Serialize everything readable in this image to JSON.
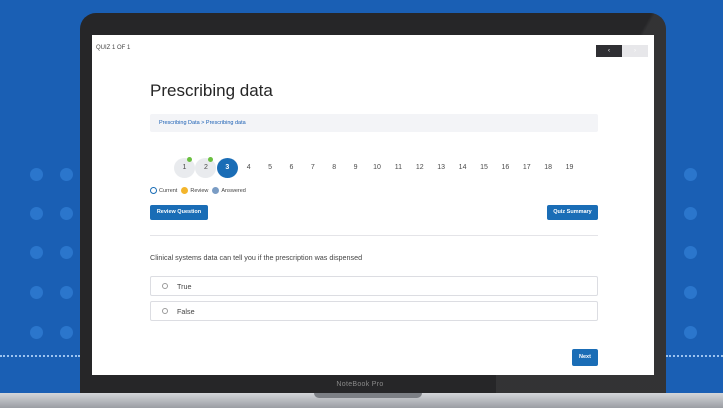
{
  "header": {
    "quiz_count": "QUIZ 1 OF 1",
    "prev_icon": "‹",
    "next_icon": "›"
  },
  "page": {
    "title": "Prescribing data",
    "breadcrumb": "Prescribing Data > Prescribing data"
  },
  "pager": {
    "pages": [
      "1",
      "2",
      "3",
      "4",
      "5",
      "6",
      "7",
      "8",
      "9",
      "10",
      "11",
      "12",
      "13",
      "14",
      "15",
      "16",
      "17",
      "18",
      "19"
    ],
    "current": "3",
    "review_pages": [
      "1",
      "2"
    ]
  },
  "legend": {
    "current": "Current",
    "review": "Review",
    "answered": "Answered"
  },
  "buttons": {
    "review_question": "Review Question",
    "quiz_summary": "Quiz Summary",
    "next": "Next"
  },
  "question": {
    "text": "Clinical systems data can tell you if the prescription was dispensed",
    "options": [
      "True",
      "False"
    ]
  },
  "device": {
    "brand": "NoteBook Pro"
  },
  "colors": {
    "background": "#1a5fb4",
    "primary": "#1a6db6",
    "review": "#f3b52c",
    "answered": "#7a9cc4",
    "indicator": "#6abf3f"
  }
}
